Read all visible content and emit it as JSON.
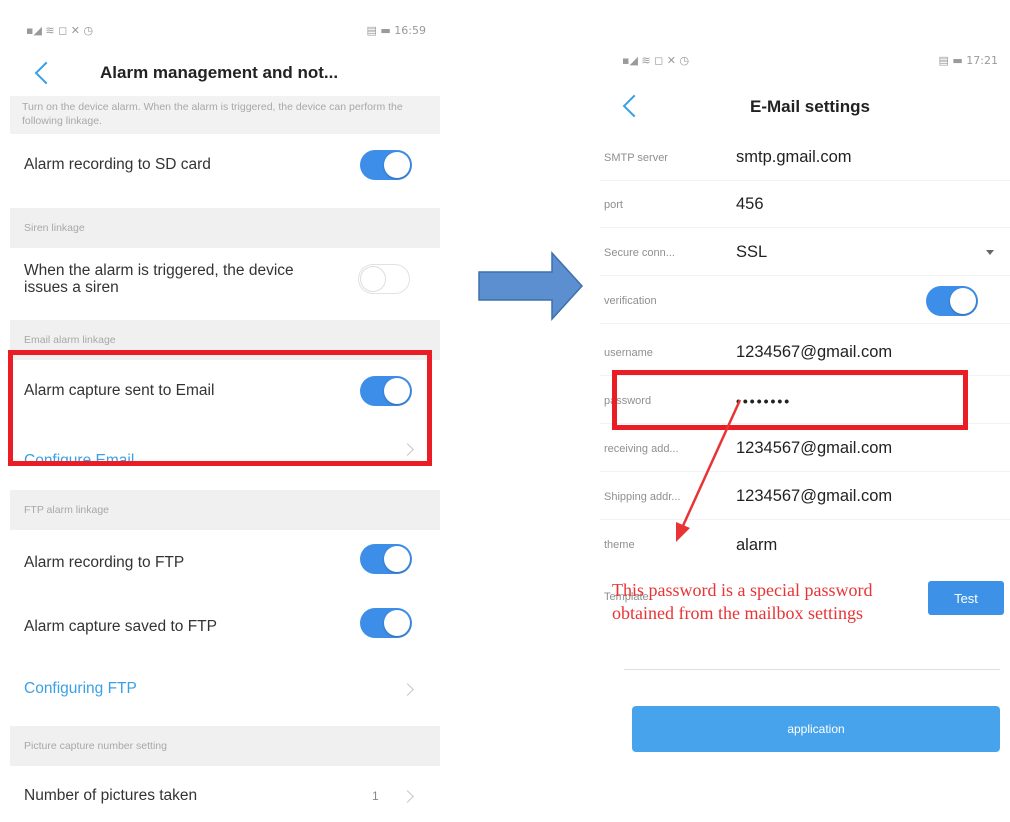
{
  "left_screen": {
    "status_time": "16:59",
    "title": "Alarm management and not...",
    "description": "Turn on the device alarm. When the alarm is triggered, the device can perform the following linkage.",
    "alarm_recording_sd": {
      "label": "Alarm recording to SD card",
      "on": true
    },
    "siren_section": "Siren linkage",
    "siren_row": {
      "label": "When the alarm is triggered, the device issues a siren",
      "on": false
    },
    "email_section": "Email alarm linkage",
    "email_capture": {
      "label": "Alarm capture sent to Email",
      "on": true
    },
    "configure_email": "Configure Email",
    "ftp_section": "FTP alarm linkage",
    "ftp_recording": {
      "label": "Alarm recording to FTP",
      "on": true
    },
    "ftp_capture": {
      "label": "Alarm capture saved to FTP",
      "on": true
    },
    "configuring_ftp": "Configuring FTP",
    "picture_section": "Picture capture number setting",
    "pictures_taken": {
      "label": "Number of pictures taken",
      "value": "1"
    }
  },
  "right_screen": {
    "status_time": "17:21",
    "title": "E-Mail settings",
    "fields": {
      "smtp_server": {
        "label": "SMTP server",
        "value": "smtp.gmail.com"
      },
      "port": {
        "label": "port",
        "value": "456"
      },
      "secure_connection": {
        "label": "Secure conn...",
        "value": "SSL"
      },
      "verification": {
        "label": "verification",
        "on": true
      },
      "username": {
        "label": "username",
        "value": "1234567@gmail.com"
      },
      "password": {
        "label": "password",
        "value": "••••••••"
      },
      "receiving_address": {
        "label": "receiving add...",
        "value": "1234567@gmail.com"
      },
      "shipping_address": {
        "label": "Shipping addr...",
        "value": "1234567@gmail.com"
      },
      "theme": {
        "label": "theme",
        "value": "alarm"
      }
    },
    "template_label": "Template",
    "test_button": "Test",
    "apply_button": "application"
  },
  "annotation": {
    "line1": "This password is a special password",
    "line2": "obtained from the mailbox settings"
  },
  "colors": {
    "accent_blue": "#3d8ee8",
    "link_blue": "#3aa0e6",
    "highlight_red": "#ea1c24",
    "arrow_blue": "#5b8fd0"
  }
}
